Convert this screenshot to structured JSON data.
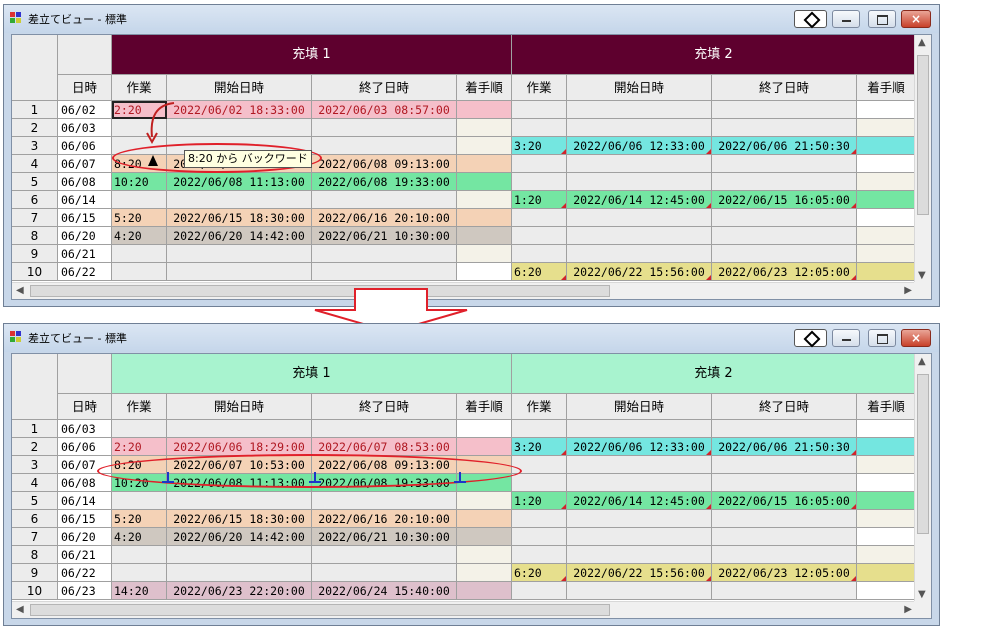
{
  "window_title": "差立てビュー - 標準",
  "close_glyph": "×",
  "columns": {
    "date": "日時",
    "work": "作業",
    "start": "開始日時",
    "end": "終了日時",
    "order": "着手順"
  },
  "colors": {
    "accent_dark": "#5e002e",
    "accent_light": "#a8f3cf",
    "pink": "#f5bfca",
    "beige": "#f4d2b6",
    "green": "#74e6a2",
    "gray": "#cfc8c0",
    "mauve": "#dec0cc",
    "cyan": "#74e6e0",
    "yellow": "#e6df8d",
    "alert_red": "#e0202a"
  },
  "before": {
    "groups": [
      "充填 1",
      "充填 2"
    ],
    "tooltip": "8:20 から バックワード",
    "rows": [
      {
        "n": "1",
        "date": "06/02",
        "g1": {
          "work": "2:20",
          "start": "2022/06/02 18:33:00",
          "end": "2022/06/03 08:57:00",
          "color": "pink"
        }
      },
      {
        "n": "2",
        "date": "06/03"
      },
      {
        "n": "3",
        "date": "06/06",
        "g2": {
          "work": "3:20",
          "start": "2022/06/06 12:33:00",
          "end": "2022/06/06 21:50:30",
          "color": "cyan"
        }
      },
      {
        "n": "4",
        "date": "06/07",
        "g1": {
          "work": "8:20",
          "start": "2022/06/07 10:53:00",
          "end": "2022/06/08 09:13:00",
          "color": "beige"
        }
      },
      {
        "n": "5",
        "date": "06/08",
        "g1": {
          "work": "10:20",
          "start": "2022/06/08 11:13:00",
          "end": "2022/06/08 19:33:00",
          "color": "green"
        }
      },
      {
        "n": "6",
        "date": "06/14",
        "g2": {
          "work": "1:20",
          "start": "2022/06/14 12:45:00",
          "end": "2022/06/15 16:05:00",
          "color": "green"
        }
      },
      {
        "n": "7",
        "date": "06/15",
        "g1": {
          "work": "5:20",
          "start": "2022/06/15 18:30:00",
          "end": "2022/06/16 20:10:00",
          "color": "beige"
        }
      },
      {
        "n": "8",
        "date": "06/20",
        "g1": {
          "work": "4:20",
          "start": "2022/06/20 14:42:00",
          "end": "2022/06/21 10:30:00",
          "color": "gray"
        }
      },
      {
        "n": "9",
        "date": "06/21"
      },
      {
        "n": "10",
        "date": "06/22",
        "g2": {
          "work": "6:20",
          "start": "2022/06/22 15:56:00",
          "end": "2022/06/23 12:05:00",
          "color": "yellow"
        }
      }
    ]
  },
  "after": {
    "groups": [
      "充填 1",
      "充填 2"
    ],
    "rows": [
      {
        "n": "1",
        "date": "06/03"
      },
      {
        "n": "2",
        "date": "06/06",
        "g1": {
          "work": "2:20",
          "start": "2022/06/06 18:29:00",
          "end": "2022/06/07 08:53:00",
          "color": "pink"
        },
        "g2": {
          "work": "3:20",
          "start": "2022/06/06 12:33:00",
          "end": "2022/06/06 21:50:30",
          "color": "cyan"
        }
      },
      {
        "n": "3",
        "date": "06/07",
        "g1": {
          "work": "8:20",
          "start": "2022/06/07 10:53:00",
          "end": "2022/06/08 09:13:00",
          "color": "beige"
        }
      },
      {
        "n": "4",
        "date": "06/08",
        "g1": {
          "work": "10:20",
          "start": "2022/06/08 11:13:00",
          "end": "2022/06/08 19:33:00",
          "color": "green"
        }
      },
      {
        "n": "5",
        "date": "06/14",
        "g2": {
          "work": "1:20",
          "start": "2022/06/14 12:45:00",
          "end": "2022/06/15 16:05:00",
          "color": "green"
        }
      },
      {
        "n": "6",
        "date": "06/15",
        "g1": {
          "work": "5:20",
          "start": "2022/06/15 18:30:00",
          "end": "2022/06/16 20:10:00",
          "color": "beige"
        }
      },
      {
        "n": "7",
        "date": "06/20",
        "g1": {
          "work": "4:20",
          "start": "2022/06/20 14:42:00",
          "end": "2022/06/21 10:30:00",
          "color": "gray"
        }
      },
      {
        "n": "8",
        "date": "06/21"
      },
      {
        "n": "9",
        "date": "06/22",
        "g2": {
          "work": "6:20",
          "start": "2022/06/22 15:56:00",
          "end": "2022/06/23 12:05:00",
          "color": "yellow"
        }
      },
      {
        "n": "10",
        "date": "06/23",
        "g1": {
          "work": "14:20",
          "start": "2022/06/23 22:20:00",
          "end": "2022/06/24 15:40:00",
          "color": "mauve"
        }
      }
    ]
  }
}
